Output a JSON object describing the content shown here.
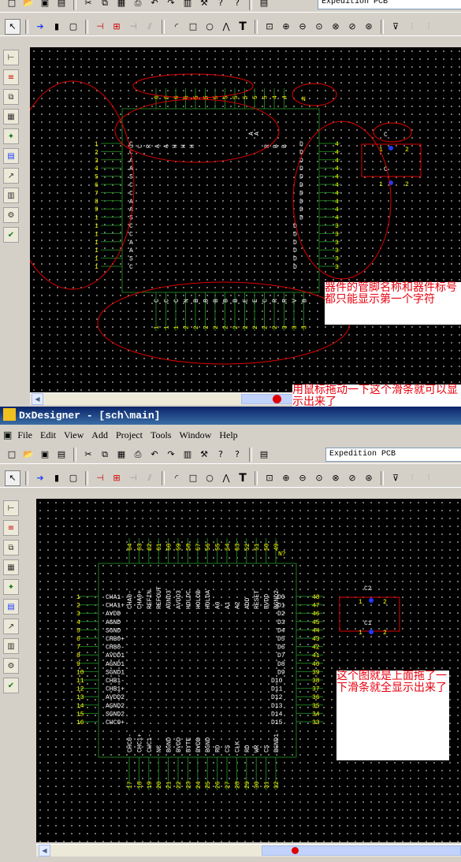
{
  "top": {
    "toolbar2": {
      "combo_value": "Expedition PCB"
    },
    "chip": {
      "pin_top": [
        "6",
        "6",
        "6",
        "6",
        "5",
        "5",
        "5",
        "5",
        "5",
        "5",
        "5",
        "5",
        "4",
        "4"
      ],
      "pin_left_nums": [
        "1",
        "2",
        "3",
        "4",
        "5",
        "6",
        "7",
        "8",
        "9",
        "1",
        "1",
        "1",
        "1",
        "1",
        "1",
        "1"
      ],
      "pin_right_nums": [
        "4",
        "4",
        "4",
        "4",
        "4",
        "4",
        "4",
        "4",
        "4",
        "4",
        "3",
        "3",
        "3",
        "3",
        "3",
        "3"
      ],
      "pin_bottom": [
        "1",
        "1",
        "1",
        "2",
        "2",
        "2",
        "2",
        "2",
        "2",
        "2",
        "2",
        "2",
        "2",
        "3",
        "3",
        "3"
      ],
      "left_names": [
        "C",
        "C",
        "A",
        "A",
        "S",
        "C",
        "C",
        "A",
        "A",
        "S",
        "C",
        "C",
        "A",
        "A",
        "S",
        "C"
      ],
      "right_names": [
        "D",
        "D",
        "D",
        "D",
        "D",
        "D",
        "D",
        "D",
        "D",
        "D",
        "D",
        "D",
        "D",
        "D",
        "D",
        "D"
      ],
      "top_names": [
        "C",
        "C",
        "R",
        "A",
        "A",
        "H",
        "H",
        "H"
      ],
      "top_right_names": [
        "R",
        "B",
        "B"
      ],
      "bottom_names": [
        "C",
        "C",
        "C",
        "N",
        "B",
        "B",
        "B",
        "B",
        "B",
        "E",
        "E",
        "C",
        "R",
        "R",
        "V",
        "B"
      ],
      "misc_n": "N",
      "misc_a": "A",
      "comp_c": "C",
      "comp_pin1": "1",
      "comp_pin2": "2"
    },
    "note": "器件的管脚名称和器件标号都只能显示第一个字符",
    "scroll_note": "用鼠标拖动一下这个滑条就可以显示出来了"
  },
  "window": {
    "title": "DxDesigner - [sch\\main]",
    "menu": [
      "File",
      "Edit",
      "View",
      "Add",
      "Project",
      "Tools",
      "Window",
      "Help"
    ],
    "combo_value": "Expedition PCB"
  },
  "bottom": {
    "chip": {
      "refdes": "N?",
      "pin_top": [
        "64",
        "63",
        "62",
        "61",
        "60",
        "59",
        "58",
        "57",
        "56",
        "55",
        "54",
        "53",
        "52",
        "51",
        "50",
        "49"
      ],
      "top_names": [
        "CHA0-",
        "CHA0+",
        "REFIN",
        "REFOUT",
        "AGND3",
        "AVDD3",
        "HOLDC",
        "HOLDB",
        "HOLDA",
        "A0",
        "A1",
        "A2",
        "ADD",
        "RESET",
        "BVDD",
        "BGND2"
      ],
      "left_nums": [
        "1",
        "2",
        "3",
        "4",
        "5",
        "6",
        "7",
        "8",
        "9",
        "10",
        "11",
        "12",
        "13",
        "14",
        "15",
        "16"
      ],
      "left_names": [
        "CHA1-",
        "CHA1+",
        "AVDD",
        "AGND",
        "SGND",
        "CHB0+",
        "CHB0-",
        "AVDD1",
        "AGND1",
        "SGND1",
        "CHB1-",
        "CHB1+",
        "AVDD2",
        "AGND2",
        "SGND2",
        "CHC0+"
      ],
      "right_names": [
        "D0",
        "D1",
        "D2",
        "D3",
        "D4",
        "D5",
        "D6",
        "D7",
        "D8",
        "D9",
        "D10",
        "D11",
        "D12",
        "D13",
        "D14",
        "D15"
      ],
      "right_nums": [
        "48",
        "47",
        "46",
        "45",
        "44",
        "43",
        "42",
        "41",
        "40",
        "39",
        "38",
        "37",
        "36",
        "35",
        "34",
        "33"
      ],
      "bottom_names": [
        "CHC0-",
        "CHC1+",
        "CHC1-",
        "NC",
        "BGND",
        "BVDD",
        "BYTE",
        "BVDD",
        "BGND",
        "RD",
        "CS",
        "CLK",
        "RD",
        "WR",
        "CS",
        "BGND1"
      ],
      "bottom_nums": [
        "17",
        "18",
        "19",
        "20",
        "21",
        "22",
        "23",
        "24",
        "25",
        "26",
        "27",
        "28",
        "29",
        "30",
        "31",
        "32"
      ],
      "comp1_ref": "C2",
      "comp2_ref": "C1",
      "pin1": "1",
      "pin2": "2"
    },
    "note": "这个图就是上面拖了一下滑条就全显示出来了"
  },
  "colors": {
    "canvas": "#000000",
    "wire": "#1e7a1e",
    "pin_text": "#ffff00",
    "name_text": "#ffffff",
    "component": "#e00000",
    "annotation": "#e00000",
    "pin_blue": "#1c3cff"
  }
}
